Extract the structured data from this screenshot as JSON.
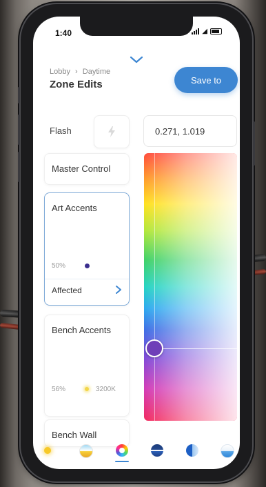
{
  "status_bar": {
    "time": "1:40"
  },
  "header": {
    "breadcrumb": {
      "parent": "Lobby",
      "separator": "›",
      "current": "Daytime"
    },
    "title": "Zone Edits",
    "save_label": "Save to"
  },
  "flash": {
    "label": "Flash",
    "coordinates": "0.271, 1.019"
  },
  "zones": [
    {
      "name": "Master Control"
    },
    {
      "name": "Art Accents",
      "percent": "50%",
      "status": "Affected",
      "selected": true
    },
    {
      "name": "Bench Accents",
      "percent": "56%",
      "color_temp": "3200K"
    },
    {
      "name": "Bench Wall"
    }
  ],
  "picker": {
    "handle_x_fraction": 0.11,
    "handle_y_fraction": 0.73,
    "handle_color": "#6f3fb8"
  },
  "colors": {
    "accent": "#3d86d2",
    "selected_border": "#7eaad8"
  },
  "tabbar": {
    "items": [
      "warm-light-icon",
      "sunrise-scene-icon",
      "color-wheel-icon",
      "horizon-scene-icon",
      "half-circle-icon",
      "water-scene-icon"
    ],
    "active_index": 2
  }
}
